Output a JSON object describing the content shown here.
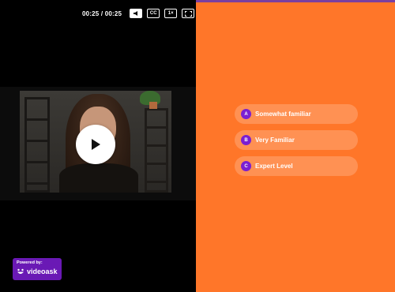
{
  "player": {
    "time_display": "00:25 / 00:25",
    "captions_label": "CC",
    "speed_label": "1×"
  },
  "badge": {
    "powered_by": "Powered by:",
    "brand": "videoask"
  },
  "answers": [
    {
      "letter": "A",
      "label": "Somewhat familiar"
    },
    {
      "letter": "B",
      "label": "Very Familiar"
    },
    {
      "letter": "C",
      "label": "Expert Level"
    }
  ],
  "colors": {
    "right_background": "#ff7629",
    "accent_purple": "#7a1fd1",
    "badge_purple": "#6a19b5",
    "left_background": "#000000"
  },
  "icons": {
    "volume": "speaker-icon",
    "fullscreen": "fullscreen-icon",
    "play": "play-icon",
    "brand": "smile-icon"
  }
}
